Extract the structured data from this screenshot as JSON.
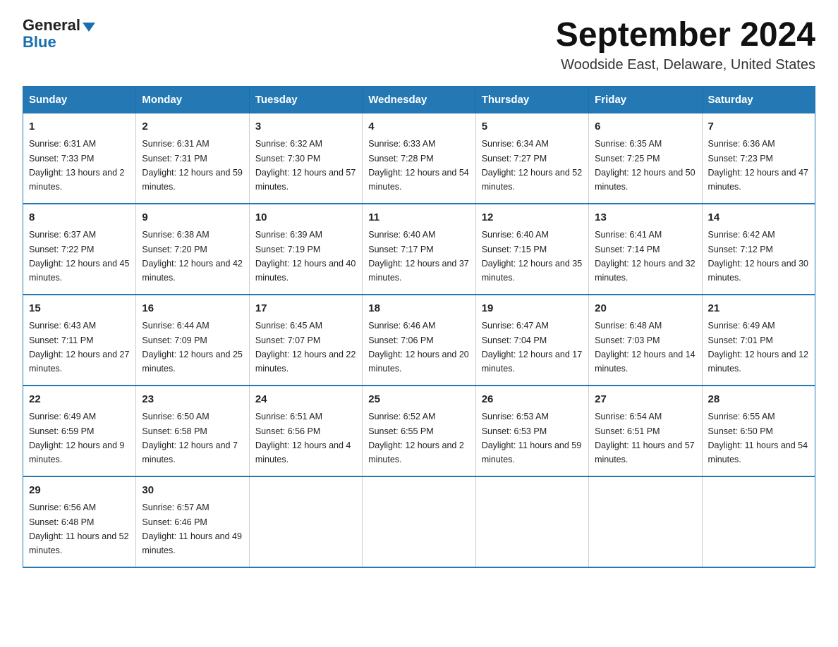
{
  "logo": {
    "text_general": "General",
    "text_blue": "Blue"
  },
  "title": "September 2024",
  "subtitle": "Woodside East, Delaware, United States",
  "days_of_week": [
    "Sunday",
    "Monday",
    "Tuesday",
    "Wednesday",
    "Thursday",
    "Friday",
    "Saturday"
  ],
  "weeks": [
    [
      {
        "day": "1",
        "sunrise": "6:31 AM",
        "sunset": "7:33 PM",
        "daylight": "13 hours and 2 minutes."
      },
      {
        "day": "2",
        "sunrise": "6:31 AM",
        "sunset": "7:31 PM",
        "daylight": "12 hours and 59 minutes."
      },
      {
        "day": "3",
        "sunrise": "6:32 AM",
        "sunset": "7:30 PM",
        "daylight": "12 hours and 57 minutes."
      },
      {
        "day": "4",
        "sunrise": "6:33 AM",
        "sunset": "7:28 PM",
        "daylight": "12 hours and 54 minutes."
      },
      {
        "day": "5",
        "sunrise": "6:34 AM",
        "sunset": "7:27 PM",
        "daylight": "12 hours and 52 minutes."
      },
      {
        "day": "6",
        "sunrise": "6:35 AM",
        "sunset": "7:25 PM",
        "daylight": "12 hours and 50 minutes."
      },
      {
        "day": "7",
        "sunrise": "6:36 AM",
        "sunset": "7:23 PM",
        "daylight": "12 hours and 47 minutes."
      }
    ],
    [
      {
        "day": "8",
        "sunrise": "6:37 AM",
        "sunset": "7:22 PM",
        "daylight": "12 hours and 45 minutes."
      },
      {
        "day": "9",
        "sunrise": "6:38 AM",
        "sunset": "7:20 PM",
        "daylight": "12 hours and 42 minutes."
      },
      {
        "day": "10",
        "sunrise": "6:39 AM",
        "sunset": "7:19 PM",
        "daylight": "12 hours and 40 minutes."
      },
      {
        "day": "11",
        "sunrise": "6:40 AM",
        "sunset": "7:17 PM",
        "daylight": "12 hours and 37 minutes."
      },
      {
        "day": "12",
        "sunrise": "6:40 AM",
        "sunset": "7:15 PM",
        "daylight": "12 hours and 35 minutes."
      },
      {
        "day": "13",
        "sunrise": "6:41 AM",
        "sunset": "7:14 PM",
        "daylight": "12 hours and 32 minutes."
      },
      {
        "day": "14",
        "sunrise": "6:42 AM",
        "sunset": "7:12 PM",
        "daylight": "12 hours and 30 minutes."
      }
    ],
    [
      {
        "day": "15",
        "sunrise": "6:43 AM",
        "sunset": "7:11 PM",
        "daylight": "12 hours and 27 minutes."
      },
      {
        "day": "16",
        "sunrise": "6:44 AM",
        "sunset": "7:09 PM",
        "daylight": "12 hours and 25 minutes."
      },
      {
        "day": "17",
        "sunrise": "6:45 AM",
        "sunset": "7:07 PM",
        "daylight": "12 hours and 22 minutes."
      },
      {
        "day": "18",
        "sunrise": "6:46 AM",
        "sunset": "7:06 PM",
        "daylight": "12 hours and 20 minutes."
      },
      {
        "day": "19",
        "sunrise": "6:47 AM",
        "sunset": "7:04 PM",
        "daylight": "12 hours and 17 minutes."
      },
      {
        "day": "20",
        "sunrise": "6:48 AM",
        "sunset": "7:03 PM",
        "daylight": "12 hours and 14 minutes."
      },
      {
        "day": "21",
        "sunrise": "6:49 AM",
        "sunset": "7:01 PM",
        "daylight": "12 hours and 12 minutes."
      }
    ],
    [
      {
        "day": "22",
        "sunrise": "6:49 AM",
        "sunset": "6:59 PM",
        "daylight": "12 hours and 9 minutes."
      },
      {
        "day": "23",
        "sunrise": "6:50 AM",
        "sunset": "6:58 PM",
        "daylight": "12 hours and 7 minutes."
      },
      {
        "day": "24",
        "sunrise": "6:51 AM",
        "sunset": "6:56 PM",
        "daylight": "12 hours and 4 minutes."
      },
      {
        "day": "25",
        "sunrise": "6:52 AM",
        "sunset": "6:55 PM",
        "daylight": "12 hours and 2 minutes."
      },
      {
        "day": "26",
        "sunrise": "6:53 AM",
        "sunset": "6:53 PM",
        "daylight": "11 hours and 59 minutes."
      },
      {
        "day": "27",
        "sunrise": "6:54 AM",
        "sunset": "6:51 PM",
        "daylight": "11 hours and 57 minutes."
      },
      {
        "day": "28",
        "sunrise": "6:55 AM",
        "sunset": "6:50 PM",
        "daylight": "11 hours and 54 minutes."
      }
    ],
    [
      {
        "day": "29",
        "sunrise": "6:56 AM",
        "sunset": "6:48 PM",
        "daylight": "11 hours and 52 minutes."
      },
      {
        "day": "30",
        "sunrise": "6:57 AM",
        "sunset": "6:46 PM",
        "daylight": "11 hours and 49 minutes."
      },
      null,
      null,
      null,
      null,
      null
    ]
  ]
}
